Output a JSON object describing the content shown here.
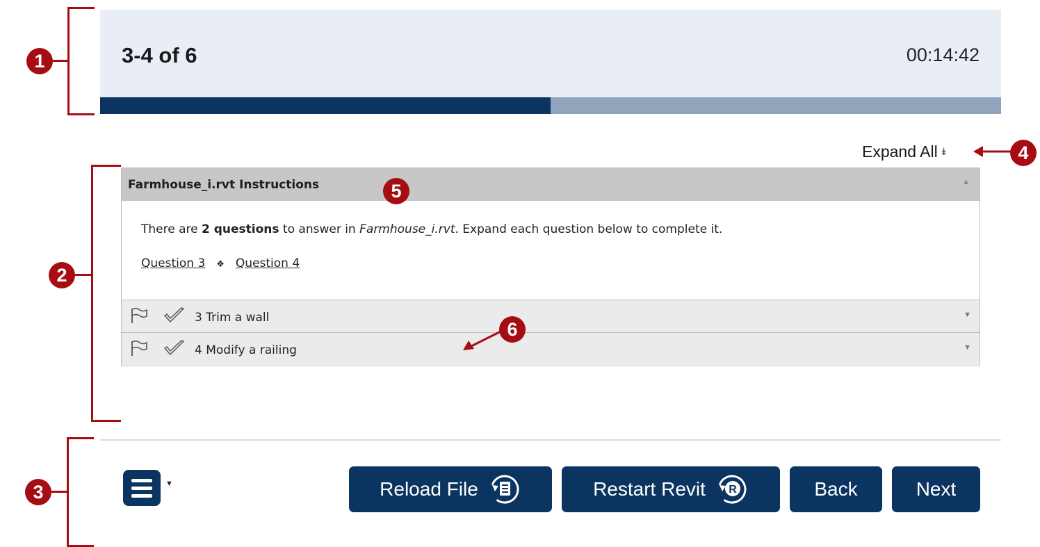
{
  "header": {
    "progress_text": "3-4 of 6",
    "timer": "00:14:42",
    "progress_fraction": 0.5
  },
  "expand_all": {
    "label": "Expand All",
    "icon": "double-chevron-down-icon"
  },
  "panel": {
    "title": "Farmhouse_i.rvt Instructions",
    "intro": {
      "prefix": "There are ",
      "count": "2 questions",
      "middle": " to answer in ",
      "file": "Farmhouse_i.rvt",
      "suffix": ". Expand each question below to complete it."
    },
    "links": [
      "Question 3",
      "Question 4"
    ],
    "link_separator": "❖",
    "questions": [
      {
        "label": "3 Trim a wall"
      },
      {
        "label": "4 Modify a railing"
      }
    ]
  },
  "footer": {
    "menu_icon": "hamburger-menu-icon",
    "buttons": {
      "reload": "Reload File",
      "restart": "Restart Revit",
      "back": "Back",
      "next": "Next"
    }
  },
  "callouts": [
    "1",
    "2",
    "3",
    "4",
    "5",
    "6"
  ],
  "colors": {
    "navy": "#0b3461",
    "callout_red": "#a50d12",
    "header_bg": "#e9eef6",
    "progress_track": "#90a4bb"
  }
}
